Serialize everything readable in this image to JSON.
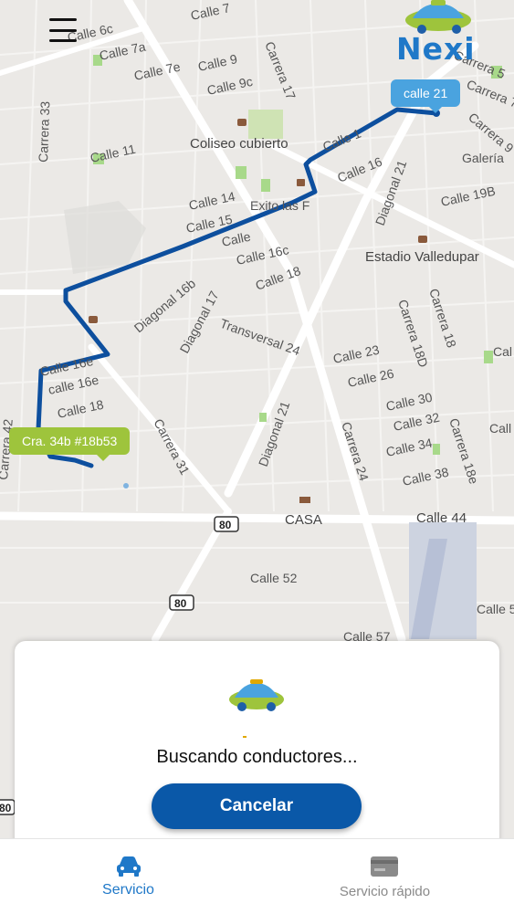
{
  "map": {
    "streets": [
      "Calle 7",
      "Calle 6c",
      "Calle 7a",
      "Calle 7e",
      "Calle 9",
      "Calle 9c",
      "Carrera 17",
      "Carrera 33",
      "Calle 11",
      "Coliseo cubierto",
      "Calle 14",
      "Calle 15",
      "Calle 16",
      "Calle 16c",
      "Calle 18",
      "Diagonal 16b",
      "Diagonal 17",
      "Transversal 24",
      "Calle 16e",
      "Carrera 31",
      "Diagonal 21",
      "Estadio Valledupar",
      "Carrera 18D",
      "Carrera 18",
      "Calle 23",
      "Calle 26",
      "Calle 30",
      "Calle 32",
      "Calle 34",
      "Calle 38",
      "Carrera 24",
      "Carrera 18e",
      "Calle 44",
      "CASA",
      "Calle 52",
      "Calle 57",
      "Calle 5",
      "Calle 19B",
      "Carrera 5",
      "Carrera 7",
      "Carrera 9",
      "Galería",
      "Exito las F",
      "80",
      "Carrera 42",
      "Calle 1",
      "Calle 16e",
      "Calle 18",
      "Call",
      "Cal",
      "Calle 4"
    ],
    "route_color": "#0d4f9e",
    "destination_tag": "calle 21",
    "origin_tag": "Cra. 34b #18b53"
  },
  "header": {
    "brand": "Nexi"
  },
  "search": {
    "status": "Buscando conductores...",
    "cancel_label": "Cancelar"
  },
  "nav": {
    "items": [
      {
        "label": "Servicio",
        "icon": "car-icon",
        "active": true
      },
      {
        "label": "Servicio rápido",
        "icon": "card-icon",
        "active": false
      }
    ]
  },
  "colors": {
    "primary": "#0a58a8",
    "accent_blue": "#1f78c8",
    "accent_green": "#9ec43c",
    "map_bg": "#ebe9e6"
  }
}
